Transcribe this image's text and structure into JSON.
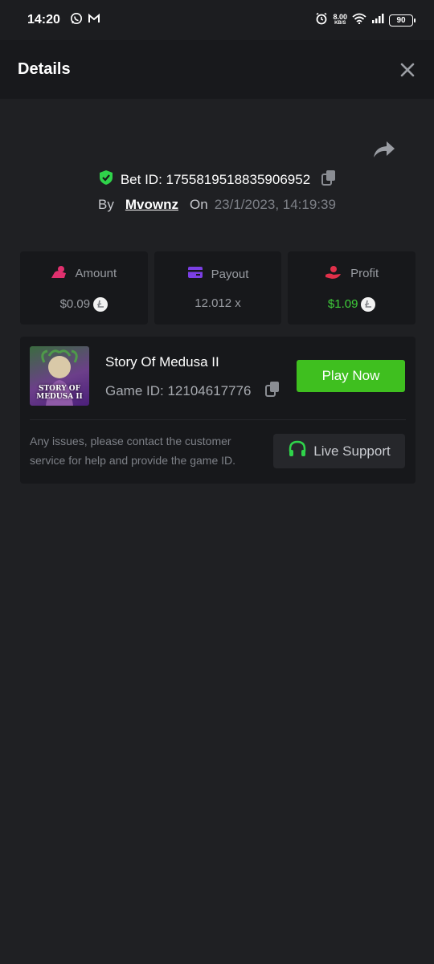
{
  "status_bar": {
    "time": "14:20",
    "net_speed_value": "8.00",
    "net_speed_unit": "KB/S",
    "battery": "90",
    "icons": [
      "whatsapp-icon",
      "gmail-icon",
      "alarm-icon",
      "wifi-icon",
      "signal-icon",
      "battery-icon"
    ]
  },
  "header": {
    "title": "Details",
    "close_icon": "close-icon"
  },
  "bet": {
    "id_label": "Bet ID: 1755819518835906952",
    "by_label": "By",
    "username": "Mvownz",
    "on_label": "On",
    "date": "23/1/2023, 14:19:39"
  },
  "stats": {
    "amount": {
      "label": "Amount",
      "value": "$0.09"
    },
    "payout": {
      "label": "Payout",
      "value": "12.012 x"
    },
    "profit": {
      "label": "Profit",
      "value": "$1.09"
    }
  },
  "game": {
    "name": "Story Of Medusa II",
    "game_id": "Game ID: 12104617776",
    "thumb_title_line1": "STORY OF",
    "thumb_title_line2": "MEDUSA II",
    "play_label": "Play Now",
    "help_text": "Any issues, please contact the customer service for help and provide the game ID.",
    "support_label": "Live Support"
  },
  "colors": {
    "accent_green": "#3fbf1f",
    "profit_green": "#3fcf3a",
    "amount_pink": "#e0306e",
    "payout_purple": "#7b3fe4",
    "profit_red": "#e0304a"
  }
}
